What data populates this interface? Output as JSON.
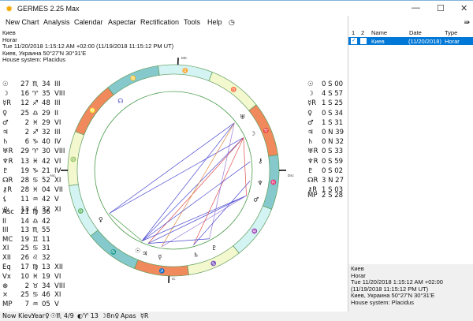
{
  "window": {
    "title": "GERMES 2.25 Max",
    "icon": "sun-icon"
  },
  "menu": [
    "New Chart",
    "Analysis",
    "Calendar",
    "Aspectar",
    "Rectification",
    "Tools",
    "Help"
  ],
  "chart_header": [
    "Киев",
    "Horar",
    "Tue 11/20/2018 1:15:12 AM +02:00 (11/19/2018 11:15:12 PM UT)",
    "Киев, Украина 50°27'N 30°31'E",
    "House system: Placidus"
  ],
  "planets": [
    {
      "g": "☉",
      "deg": "27",
      "sign": "♏",
      "min": "34",
      "house": "III",
      "lat": "0 S 00"
    },
    {
      "g": "☽",
      "deg": "16",
      "sign": "♈",
      "min": "35",
      "house": "VIII",
      "lat": "4 S 57"
    },
    {
      "g": "☿R",
      "deg": "12",
      "sign": "♐",
      "min": "48",
      "house": "III",
      "lat": "1 S 25"
    },
    {
      "g": "♀",
      "deg": "25",
      "sign": "♎",
      "min": "29",
      "house": "II",
      "lat": "0 S 34"
    },
    {
      "g": "♂",
      "deg": "2",
      "sign": "♓",
      "min": "29",
      "house": "VI",
      "lat": "1 S 31"
    },
    {
      "g": "♃",
      "deg": "2",
      "sign": "♐",
      "min": "32",
      "house": "III",
      "lat": "0 N 39"
    },
    {
      "g": "♄",
      "deg": "6",
      "sign": "♑",
      "min": "40",
      "house": "IV",
      "lat": "0 N 32"
    },
    {
      "g": "♅R",
      "deg": "29",
      "sign": "♈",
      "min": "30",
      "house": "VIII",
      "lat": "0 S 33"
    },
    {
      "g": "♆R",
      "deg": "13",
      "sign": "♓",
      "min": "42",
      "house": "VI",
      "lat": "0 S 59"
    },
    {
      "g": "♇",
      "deg": "19",
      "sign": "♑",
      "min": "21",
      "house": "IV",
      "lat": "0 S 02"
    },
    {
      "g": "☊R",
      "deg": "28",
      "sign": "♋",
      "min": "52",
      "house": "XI",
      "lat": "3 N 27"
    },
    {
      "g": "⚷R",
      "deg": "28",
      "sign": "♓",
      "min": "04",
      "house": "VII",
      "lat": "1 S 03"
    },
    {
      "g": "⚸",
      "deg": "11",
      "sign": "♒",
      "min": "42",
      "house": "V",
      "lat": ""
    },
    {
      "g": "⯓",
      "deg": "13",
      "sign": "♌",
      "min": "32",
      "house": "XI",
      "lat": ""
    }
  ],
  "mp_lat": {
    "label": "MP",
    "value": "2 S 28"
  },
  "cusps": [
    {
      "g": "Asc",
      "deg": "21",
      "sign": "♍",
      "min": "36"
    },
    {
      "g": "II",
      "deg": "14",
      "sign": "♎",
      "min": "42"
    },
    {
      "g": "III",
      "deg": "13",
      "sign": "♏",
      "min": "55"
    },
    {
      "g": "MC",
      "deg": "19",
      "sign": "♊",
      "min": "11"
    },
    {
      "g": "XI",
      "deg": "25",
      "sign": "♋",
      "min": "31"
    },
    {
      "g": "XII",
      "deg": "26",
      "sign": "♌",
      "min": "32"
    }
  ],
  "points": [
    {
      "g": "Eq",
      "deg": "17",
      "sign": "♍",
      "min": "13",
      "house": "XII"
    },
    {
      "g": "Vx",
      "deg": "10",
      "sign": "♓",
      "min": "19",
      "house": "VI"
    },
    {
      "g": "⊗",
      "deg": "2",
      "sign": "♉",
      "min": "34",
      "house": "VIII"
    },
    {
      "g": "×",
      "deg": "25",
      "sign": "♋",
      "min": "46",
      "house": "XI"
    },
    {
      "g": "MP",
      "deg": "7",
      "sign": "♒",
      "min": "05",
      "house": "V"
    }
  ],
  "wheel": {
    "asc_lon": 171.6,
    "axis_labels": {
      "mc": "MC",
      "ic": "IC",
      "asc": "Asc",
      "dsc": "Dsc"
    },
    "house_labels": [
      "XII",
      "XI",
      "IX",
      "VIII",
      "VI",
      "V",
      "III",
      "II"
    ],
    "sign_glyphs": [
      "♈",
      "♉",
      "♊",
      "♋",
      "♌",
      "♍",
      "♎",
      "♏",
      "♐",
      "♑",
      "♒",
      "♓"
    ],
    "element_colors": {
      "fire": "#f08a5d",
      "earth": "#f4f8cf",
      "air": "#d4f3f3",
      "water": "#86c9cc"
    },
    "planet_lons": [
      237.57,
      16.58,
      252.8,
      205.48,
      332.48,
      242.53,
      276.67,
      29.5,
      343.7,
      289.35,
      118.87,
      358.07
    ],
    "aspects": [
      [
        0,
        1,
        "#4a4ad0"
      ],
      [
        0,
        7,
        "#4a4ad0"
      ],
      [
        3,
        7,
        "#4a4ad0"
      ],
      [
        3,
        1,
        "#4a4ad0"
      ],
      [
        5,
        1,
        "#e05050"
      ],
      [
        2,
        7,
        "#e08a40"
      ],
      [
        4,
        0,
        "#4a4ad0"
      ],
      [
        4,
        5,
        "#4a4ad0"
      ],
      [
        4,
        2,
        "#9a7ad8"
      ],
      [
        6,
        1,
        "#e05050"
      ],
      [
        9,
        7,
        "#9a7ad8"
      ],
      [
        8,
        6,
        "#4a4ad0"
      ],
      [
        11,
        0,
        "#4a4ad0"
      ],
      [
        3,
        0,
        "#3a9a3a"
      ],
      [
        9,
        5,
        "#4a4ad0"
      ],
      [
        1,
        4,
        "#e05050"
      ]
    ]
  },
  "right_panel": {
    "cols": [
      "1",
      "2",
      "Name",
      "Date",
      "Type"
    ],
    "row": {
      "name": "Киев",
      "date": "(11/20/2018)",
      "type": "Horar"
    },
    "info": [
      "Киев",
      "Horar",
      "Tue 11/20/2018 1:15:12 AM +02:00 (11/19/2018 11:15:12 PM UT)",
      "Киев, Украина 50°27'N 30°31'E",
      "House system: Placidus"
    ]
  },
  "status": [
    "Now Kiev:",
    "Year♀",
    "☉♏ 4/9",
    "◐♈ 13",
    "☽8n♀",
    "Apas",
    "☿R"
  ]
}
